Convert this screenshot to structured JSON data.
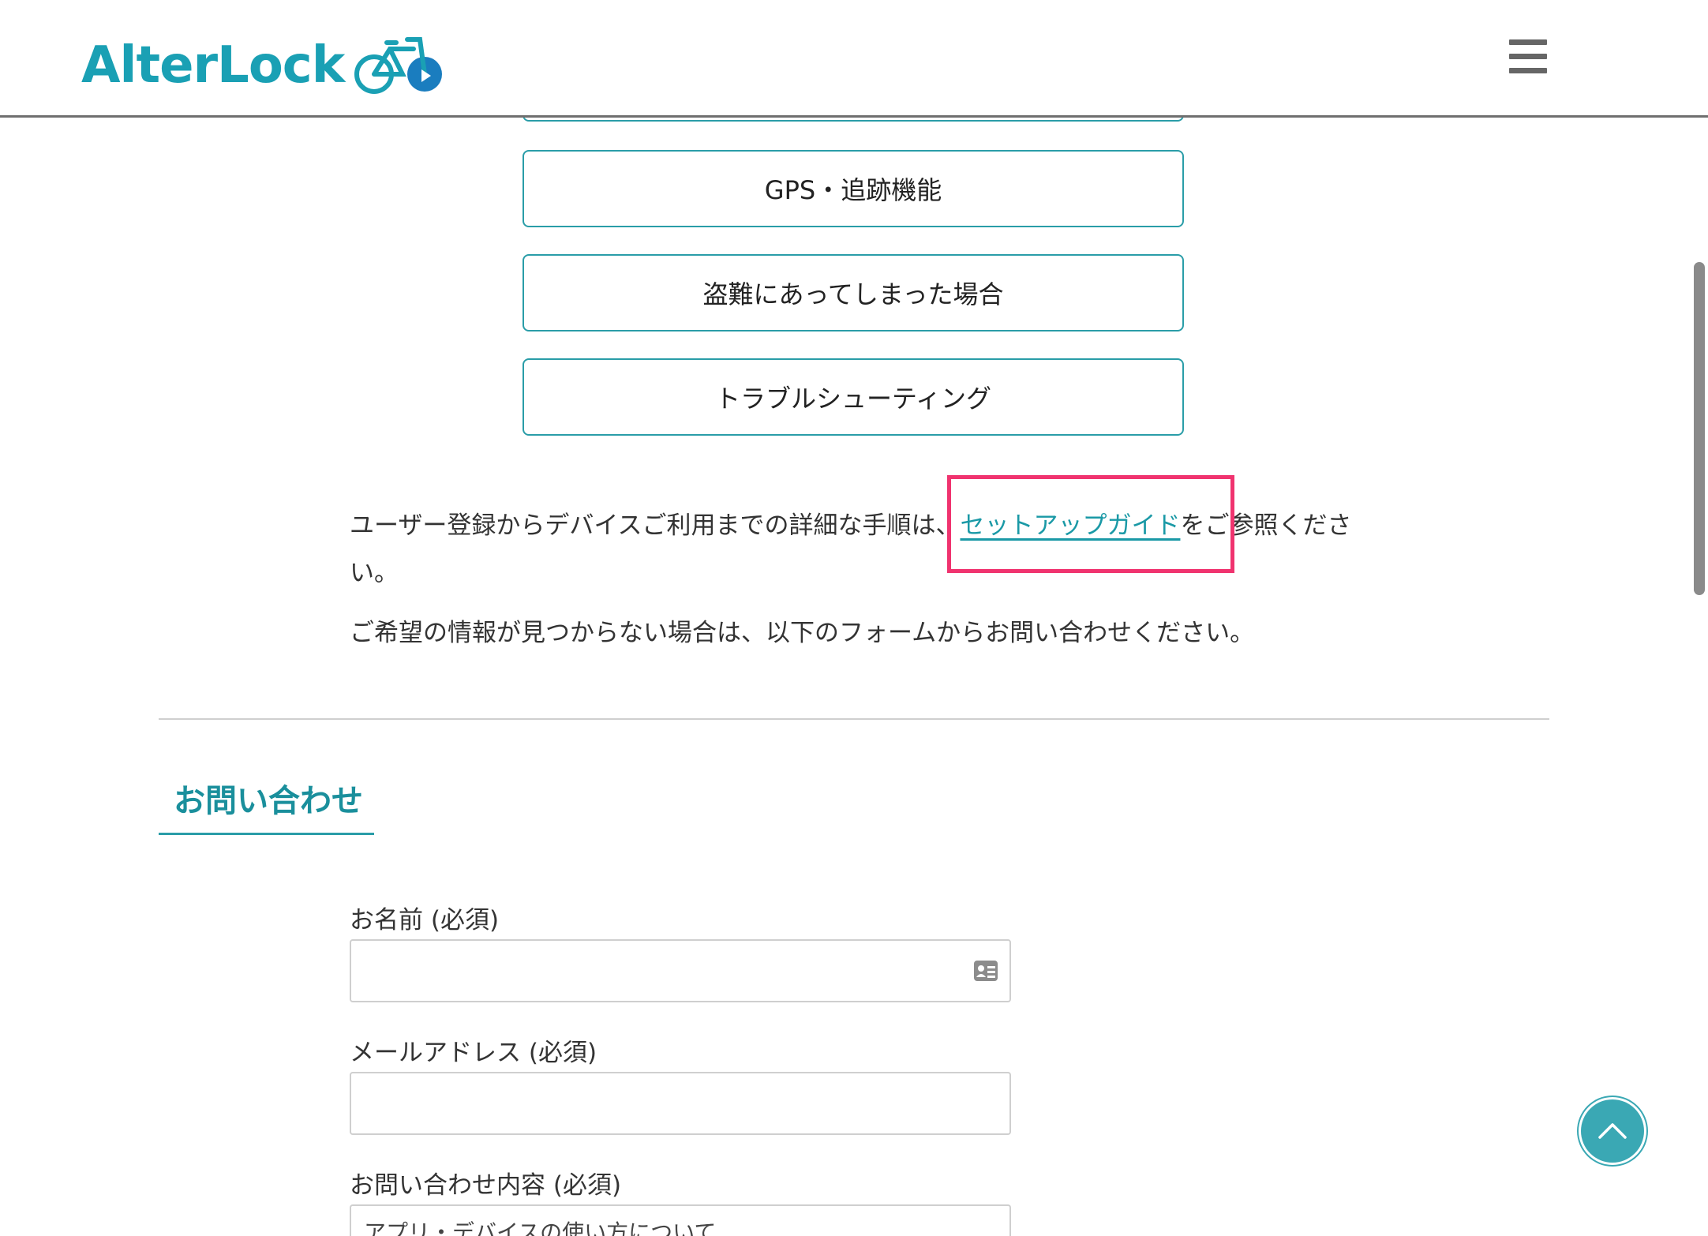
{
  "header": {
    "logo_text": "AlterLock",
    "menu_icon": "hamburger-icon"
  },
  "categories": [
    {
      "label": "GPS・追跡機能"
    },
    {
      "label": "盗難にあってしまった場合"
    },
    {
      "label": "トラブルシューティング"
    }
  ],
  "info": {
    "line1_before": "ユーザー登録からデバイスご利用までの詳細な手順は、",
    "guide_link": "セットアップガイド",
    "line1_after": "をご参照ください。",
    "line2": "ご希望の情報が見つからない場合は、以下のフォームからお問い合わせください。"
  },
  "contact": {
    "title": "お問い合わせ",
    "name_label": "お名前 (必須)",
    "email_label": "メールアドレス (必須)",
    "inquiry_label": "お問い合わせ内容 (必須)",
    "inquiry_select_partial": "アプリ・デバイスの使い方について"
  },
  "colors": {
    "accent": "#1aa0b4",
    "button_border": "#2a9da8",
    "highlight": "#f0336f",
    "to_top": "#3aa8b4"
  }
}
